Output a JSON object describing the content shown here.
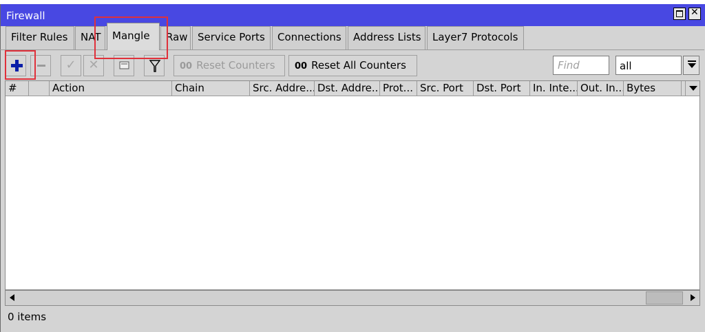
{
  "window": {
    "title": "Firewall"
  },
  "tabs": [
    {
      "label": "Filter Rules"
    },
    {
      "label": "NAT"
    },
    {
      "label": "Mangle",
      "active": true
    },
    {
      "label": "Raw"
    },
    {
      "label": "Service Ports"
    },
    {
      "label": "Connections"
    },
    {
      "label": "Address Lists"
    },
    {
      "label": "Layer7 Protocols"
    }
  ],
  "toolbar": {
    "icons": [
      "add-icon",
      "remove-icon",
      "enable-icon",
      "disable-icon",
      "comment-icon",
      "filter-icon"
    ],
    "reset_counters": {
      "prefix": "00",
      "label": "Reset Counters"
    },
    "reset_all_counters": {
      "prefix": "00",
      "label": "Reset All Counters"
    },
    "find": {
      "value": "",
      "placeholder": "Find"
    },
    "filter_select": {
      "value": "all"
    }
  },
  "table": {
    "columns": [
      "#",
      "",
      "Action",
      "Chain",
      "Src. Addre...",
      "Dst. Addre...",
      "Prot...",
      "Src. Port",
      "Dst. Port",
      "In. Inte...",
      "Out. In...",
      "Bytes"
    ],
    "rows": []
  },
  "status": {
    "text": "0 items"
  },
  "colors": {
    "titlebar": "#4848e2",
    "add_icon": "#0a1ea8",
    "highlight": "#e0303a",
    "window_bg": "#d4d4d4"
  }
}
